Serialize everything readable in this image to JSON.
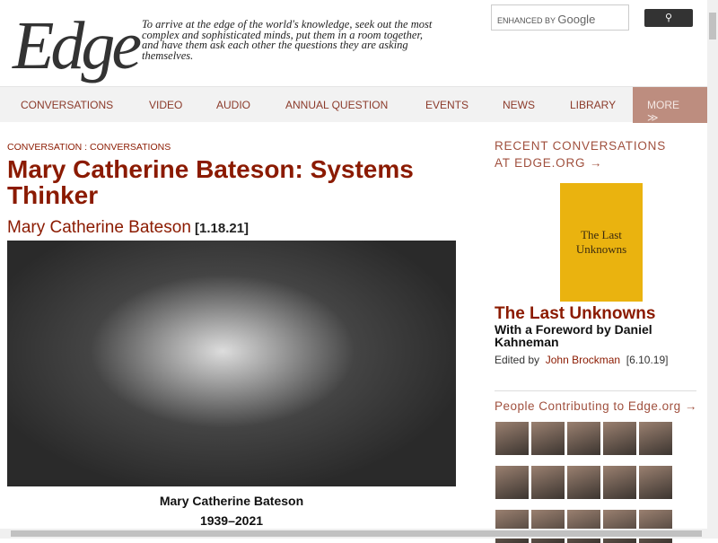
{
  "header": {
    "logo": "Edge",
    "tagline": "To arrive at the edge of the world's knowledge, seek out the most complex and sophisticated minds, put them in a room together, and have them ask each other the questions they are asking themselves.",
    "search_label": "ENHANCED BY",
    "search_brand": "Google",
    "search_icon": "magnifier"
  },
  "nav": {
    "items": [
      "CONVERSATIONS",
      "VIDEO",
      "AUDIO",
      "ANNUAL QUESTION",
      "EVENTS",
      "NEWS",
      "LIBRARY"
    ],
    "more": "MORE ≫"
  },
  "article": {
    "breadcrumb": "CONVERSATION : CONVERSATIONS",
    "title": "Mary Catherine Bateson: Systems Thinker",
    "author": "Mary Catherine Bateson",
    "date": "[1.18.21]",
    "caption_name": "Mary Catherine Bateson",
    "caption_years": "1939–2021"
  },
  "sidebar": {
    "recent": "RECENT CONVERSATIONS AT EDGE.ORG →",
    "book_cover": "The Last Unknowns",
    "book_title": "The Last Unknowns",
    "book_subtitle": "With a Foreword by Daniel Kahneman",
    "edited_by": "Edited by",
    "editor": "John Brockman",
    "book_date": "[6.10.19]",
    "people": "People Contributing to Edge.org →"
  }
}
